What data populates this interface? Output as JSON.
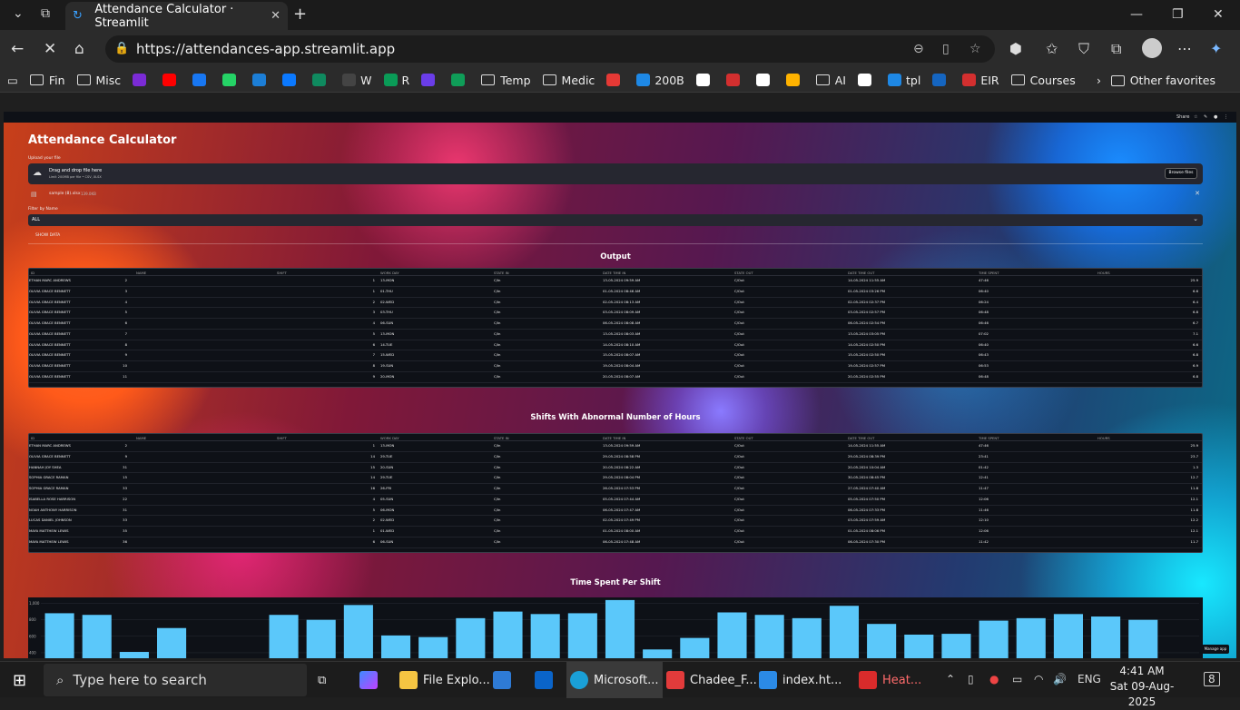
{
  "browser": {
    "tab_title": "Attendance Calculator · Streamlit",
    "url": "https://attendances-app.streamlit.app",
    "bookmarks": [
      {
        "label": "Fin",
        "type": "folder"
      },
      {
        "label": "Misc",
        "type": "folder"
      },
      {
        "label": "",
        "color": "#7b2bd6"
      },
      {
        "label": "",
        "color": "#ff0000"
      },
      {
        "label": "",
        "color": "#1877f2"
      },
      {
        "label": "",
        "color": "#25d366"
      },
      {
        "label": "",
        "color": "#1c7ed6"
      },
      {
        "label": "",
        "color": "#0b79ff"
      },
      {
        "label": "",
        "color": "#0f8a5f"
      },
      {
        "label": "W",
        "color": "#444444"
      },
      {
        "label": "R",
        "color": "#0a9b57"
      },
      {
        "label": "",
        "color": "#6a3de8"
      },
      {
        "label": "",
        "color": "#0f9d58"
      },
      {
        "label": "Temp",
        "type": "folder"
      },
      {
        "label": "Medic",
        "type": "folder"
      },
      {
        "label": "",
        "color": "#e53935"
      },
      {
        "label": "200B",
        "color": "#1e88e5"
      },
      {
        "label": "",
        "color": "#ffffff"
      },
      {
        "label": "",
        "color": "#d32f2f"
      },
      {
        "label": "",
        "color": "#ffffff"
      },
      {
        "label": "",
        "color": "#ffb300"
      },
      {
        "label": "AI",
        "type": "folder"
      },
      {
        "label": "",
        "color": "#ffffff"
      },
      {
        "label": "tpl",
        "color": "#1e88e5"
      },
      {
        "label": "",
        "color": "#1565c0"
      },
      {
        "label": "EIR",
        "color": "#d32f2f"
      },
      {
        "label": "Courses",
        "type": "folder"
      }
    ],
    "other_favorites": "Other favorites"
  },
  "streamlit": {
    "header": {
      "share": "Share",
      "manage_app": "Manage app"
    },
    "title": "Attendance Calculator",
    "uploader": {
      "label": "Upload your file",
      "drag_text": "Drag and drop file here",
      "limit_text": "Limit 200MB per file • CSV, XLSX",
      "browse": "Browse files",
      "file_name": "sample (8).xlsx",
      "file_size": "139.0KB"
    },
    "filter": {
      "label": "Filter by Name",
      "value": "ALL"
    },
    "show_data": "SHOW DATA",
    "output_title": "Output",
    "columns": [
      "ID",
      "NAME",
      "SHIFT",
      "WORK DAY",
      "STATE IN",
      "DATE TIME IN",
      "STATE OUT",
      "DATE TIME OUT",
      "TIME SPENT",
      "HOURS"
    ],
    "output_rows": [
      [
        "2",
        "ETHAN MARC ANDREWS",
        "",
        "1",
        "13-MON",
        "C/In",
        "13-05-2024 09:59 AM",
        "C/Out",
        "14-05-2024 11:55 AM",
        "47:46",
        "25.9"
      ],
      [
        "3",
        "OLIVIA GRACE BENNETT",
        "",
        "1",
        "01-THU",
        "C/In",
        "01-05-2024 08:46 AM",
        "C/Out",
        "01-05-2024 03:26 PM",
        "06:40",
        "6.6"
      ],
      [
        "4",
        "OLIVIA GRACE BENNETT",
        "",
        "2",
        "02-WED",
        "C/In",
        "02-05-2024 08:13 AM",
        "C/Out",
        "02-05-2024 02:37 PM",
        "06:24",
        "6.4"
      ],
      [
        "5",
        "OLIVIA GRACE BENNETT",
        "",
        "3",
        "03-THU",
        "C/In",
        "03-05-2024 08:09 AM",
        "C/Out",
        "03-05-2024 02:57 PM",
        "06:48",
        "6.8"
      ],
      [
        "6",
        "OLIVIA GRACE BENNETT",
        "",
        "4",
        "06-SUN",
        "C/In",
        "06-05-2024 08:08 AM",
        "C/Out",
        "06-05-2024 02:54 PM",
        "06:46",
        "6.7"
      ],
      [
        "7",
        "OLIVIA GRACE BENNETT",
        "",
        "5",
        "13-MON",
        "C/In",
        "13-05-2024 08:03 AM",
        "C/Out",
        "13-05-2024 03:05 PM",
        "07:02",
        "7.1"
      ],
      [
        "8",
        "OLIVIA GRACE BENNETT",
        "",
        "6",
        "14-TUE",
        "C/In",
        "14-05-2024 08:10 AM",
        "C/Out",
        "14-05-2024 02:50 PM",
        "06:40",
        "6.6"
      ],
      [
        "9",
        "OLIVIA GRACE BENNETT",
        "",
        "7",
        "15-WED",
        "C/In",
        "15-05-2024 08:07 AM",
        "C/Out",
        "15-05-2024 02:50 PM",
        "06:43",
        "6.8"
      ],
      [
        "10",
        "OLIVIA GRACE BENNETT",
        "",
        "8",
        "19-SUN",
        "C/In",
        "19-05-2024 08:04 AM",
        "C/Out",
        "19-05-2024 02:57 PM",
        "06:53",
        "6.9"
      ],
      [
        "11",
        "OLIVIA GRACE BENNETT",
        "",
        "9",
        "20-MON",
        "C/In",
        "20-05-2024 08:07 AM",
        "C/Out",
        "20-05-2024 02:55 PM",
        "06:48",
        "6.8"
      ]
    ],
    "abnormal_title": "Shifts With Abnormal Number of Hours",
    "abnormal_rows": [
      [
        "2",
        "ETHAN MARC ANDREWS",
        "",
        "1",
        "13-MON",
        "C/In",
        "13-05-2024 09:59 AM",
        "C/Out",
        "14-05-2024 11:55 AM",
        "47:46",
        "25.9"
      ],
      [
        "9",
        "OLIVIA GRACE BENNETT",
        "",
        "14",
        "29-TUE",
        "C/In",
        "29-05-2024 08:58 PM",
        "C/Out",
        "29-05-2024 08:39 PM",
        "23:41",
        "23.7"
      ],
      [
        "31",
        "HANNAH JOY SHEA",
        "",
        "15",
        "20-SUN",
        "C/In",
        "20-05-2024 08:22 AM",
        "C/Out",
        "20-05-2024 10:04 AM",
        "01:42",
        "1.3"
      ],
      [
        "15",
        "SOPHIA GRACE RAMAN",
        "",
        "14",
        "29-TUE",
        "C/In",
        "29-05-2024 08:04 PM",
        "C/Out",
        "30-05-2024 08:45 PM",
        "12:41",
        "12.7"
      ],
      [
        "33",
        "SOPHIA GRACE RAMAN",
        "",
        "16",
        "26-FRI",
        "C/In",
        "26-05-2024 07:53 PM",
        "C/Out",
        "27-05-2024 07:40 AM",
        "11:47",
        "11.8"
      ],
      [
        "22",
        "ISABELLA ROSE HARRISON",
        "",
        "4",
        "05-SUN",
        "C/In",
        "05-05-2024 07:44 AM",
        "C/Out",
        "05-05-2024 07:50 PM",
        "12:06",
        "12.1"
      ],
      [
        "31",
        "NOAH ANTHONY HARRISON",
        "",
        "5",
        "06-MON",
        "C/In",
        "06-05-2024 07:47 AM",
        "C/Out",
        "06-05-2024 07:33 PM",
        "11:46",
        "11.8"
      ],
      [
        "33",
        "LUCAS DANIEL JOHNSON",
        "",
        "2",
        "02-WED",
        "C/In",
        "02-05-2024 07:49 PM",
        "C/Out",
        "03-05-2024 07:59 AM",
        "12:10",
        "12.2"
      ],
      [
        "35",
        "MAYA MATTHEW LEWIS",
        "",
        "1",
        "01-WED",
        "C/In",
        "01-05-2024 08:00 AM",
        "C/Out",
        "01-05-2024 08:06 PM",
        "12:06",
        "12.1"
      ],
      [
        "36",
        "MAYA MATTHEW LEWIS",
        "",
        "6",
        "06-SUN",
        "C/In",
        "06-05-2024 07:48 AM",
        "C/Out",
        "06-05-2024 07:30 PM",
        "11:42",
        "11.7"
      ]
    ],
    "chart_title": "Time Spent Per Shift"
  },
  "chart_data": {
    "type": "bar",
    "title": "Time Spent Per Shift",
    "xlabel": "",
    "ylabel": "",
    "y_ticks": [
      "1,000",
      "800",
      "600",
      "400"
    ],
    "ylim": [
      300,
      1050
    ],
    "values": [
      880,
      860,
      410,
      700,
      0,
      0,
      860,
      800,
      980,
      610,
      590,
      820,
      900,
      870,
      880,
      1040,
      440,
      580,
      890,
      860,
      820,
      970,
      750,
      620,
      630,
      790,
      820,
      870,
      840,
      800,
      280
    ],
    "color": "#5bc8fa"
  },
  "taskbar": {
    "search_placeholder": "Type here to search",
    "apps": [
      "File Explo...",
      "Microsoft...",
      "Chadee_F...",
      "index.ht...",
      "Heat..."
    ],
    "lang": "ENG",
    "time": "4:41 AM",
    "date": "Sat 09-Aug-2025",
    "notif_count": "8"
  }
}
